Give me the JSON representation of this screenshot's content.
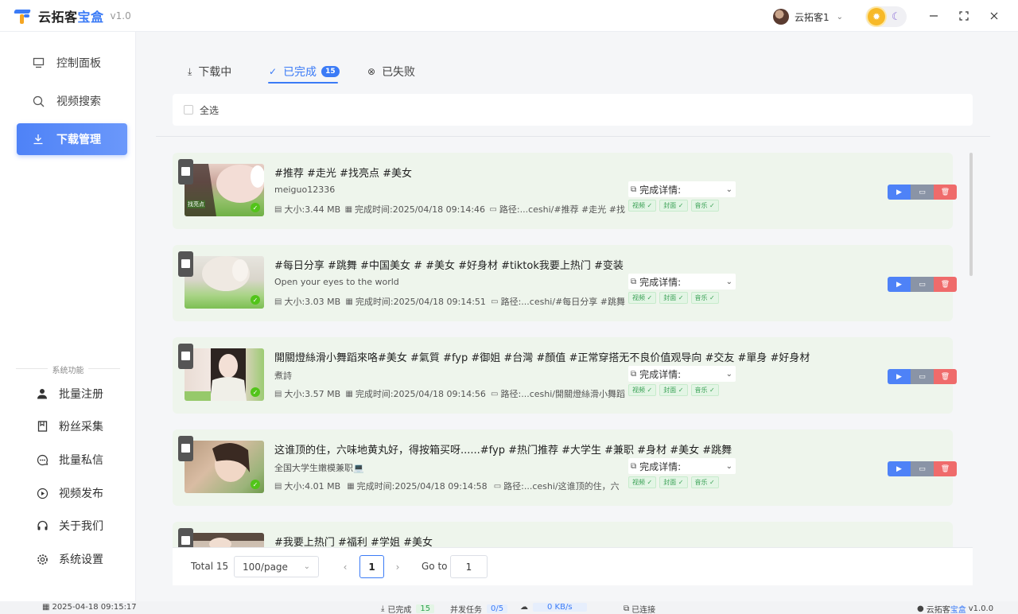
{
  "app": {
    "title_prefix": "云拓客",
    "title_accent": "宝盒",
    "version": "v1.0",
    "user_name": "云拓客1"
  },
  "sidebar": {
    "nav": [
      {
        "label": "控制面板",
        "icon": "dashboard-icon"
      },
      {
        "label": "视频搜索",
        "icon": "search-icon"
      },
      {
        "label": "下载管理",
        "icon": "download-icon",
        "active": true
      }
    ],
    "section_label": "系统功能",
    "system_items": [
      {
        "label": "批量注册",
        "icon": "user-icon"
      },
      {
        "label": "粉丝采集",
        "icon": "bookmark-icon"
      },
      {
        "label": "批量私信",
        "icon": "chat-icon"
      },
      {
        "label": "视频发布",
        "icon": "play-circle-icon"
      },
      {
        "label": "关于我们",
        "icon": "headset-icon"
      },
      {
        "label": "系统设置",
        "icon": "gear-icon"
      }
    ]
  },
  "tabs": [
    {
      "label": "下载中",
      "icon": "download-icon"
    },
    {
      "label": "已完成",
      "icon": "check-icon",
      "badge": "15",
      "active": true
    },
    {
      "label": "已失败",
      "icon": "close-circle-icon"
    }
  ],
  "select_all_label": "全选",
  "labels": {
    "size_prefix": "大小: ",
    "time_prefix": "完成时间: ",
    "path_prefix": "路径: ",
    "detail": "完成详情:",
    "tag_video": "视频",
    "tag_cover": "封面",
    "tag_music": "音乐"
  },
  "items": [
    {
      "title": "#推荐 #走光 #找亮点 #美女",
      "author": "meiguo12336",
      "size": "3.44 MB",
      "time": "2025/04/18 09:14:46",
      "path": "...ceshi/#推荐 #走光 #找",
      "watermark": "找亮点"
    },
    {
      "title": "#每日分享 #跳舞 #中国美女 # #美女 #好身材 #tiktok我要上热门 #变装",
      "author": "Open your eyes to the world",
      "size": "3.03 MB",
      "time": "2025/04/18 09:14:51",
      "path": "...ceshi/#每日分享 #跳舞"
    },
    {
      "title": "開關燈絲滑小舞蹈來咯#美女 #氣質 #fyp #御姐 #台灣 #顏值 #正常穿搭无不良价值观导向 #交友 #單身 #好身材",
      "author": "煮詩",
      "size": "3.57 MB",
      "time": "2025/04/18 09:14:56",
      "path": "...ceshi/開關燈絲滑小舞蹈"
    },
    {
      "title": "这谁顶的住，六味地黄丸好，得按箱买呀......#fyp #热门推荐 #大学生 #兼职 #身材 #美女 #跳舞",
      "author": "全国大学生嫩模兼职💻",
      "size": "4.01 MB",
      "time": "2025/04/18 09:14:58",
      "path": "...ceshi/这谁顶的住，六"
    },
    {
      "title": "#我要上热门 #福利 #学姐 #美女",
      "author": "",
      "size": "",
      "time": "",
      "path": ""
    }
  ],
  "pagination": {
    "total": "Total 15",
    "page_size": "100/page",
    "current_page": "1",
    "goto_label": "Go to",
    "goto_value": "1"
  },
  "statusbar": {
    "datetime": "2025-04-18 09:15:17",
    "completed_label": "已完成",
    "completed_count": "15",
    "concurrent_label": "并发任务",
    "concurrent_value": "0/5",
    "speed": "0 KB/s",
    "connected": "已连接",
    "brand_prefix": "云拓客",
    "brand_accent": "宝盒",
    "version": "v1.0.0"
  },
  "colors": {
    "accent": "#3b7bf6",
    "success": "#52c41a",
    "danger": "#ef6b6b",
    "item_bg": "#eef5ec"
  }
}
